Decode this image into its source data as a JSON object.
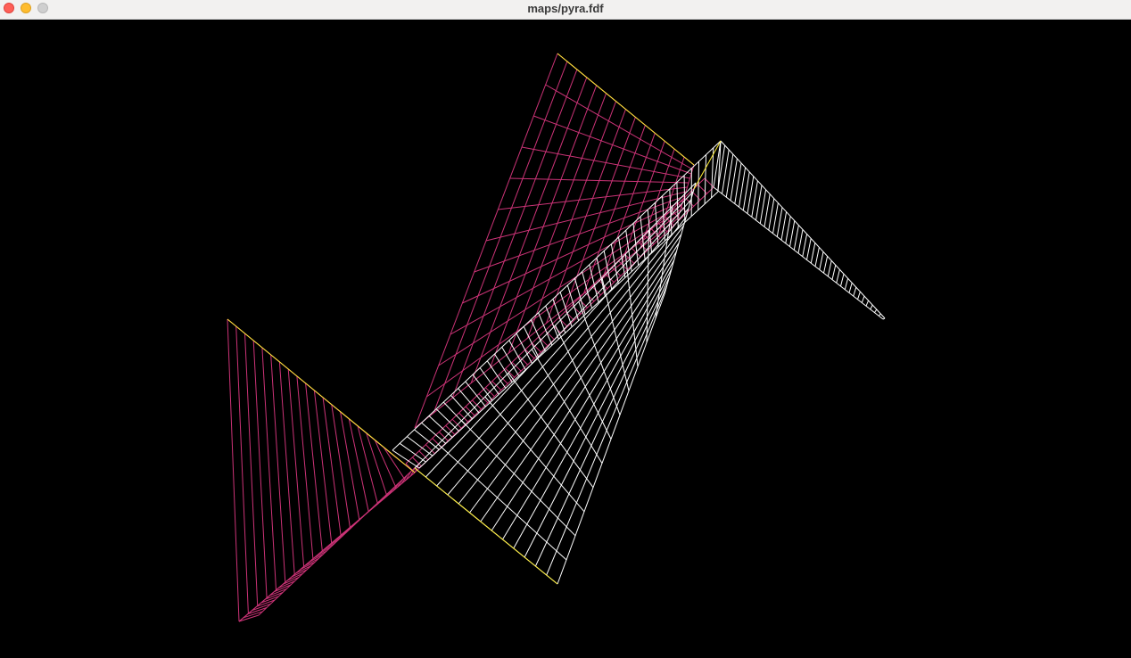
{
  "window": {
    "title": "maps/pyra.fdf",
    "controls": {
      "close": "close-icon",
      "minimize": "minimize-icon",
      "zoom": "zoom-icon"
    }
  },
  "render": {
    "background": "#000000",
    "colors": {
      "low": "#ffffff",
      "mid": "#cc3377",
      "edge": "#ffee33"
    },
    "mesh_columns": 19,
    "mesh_rows": 12
  }
}
